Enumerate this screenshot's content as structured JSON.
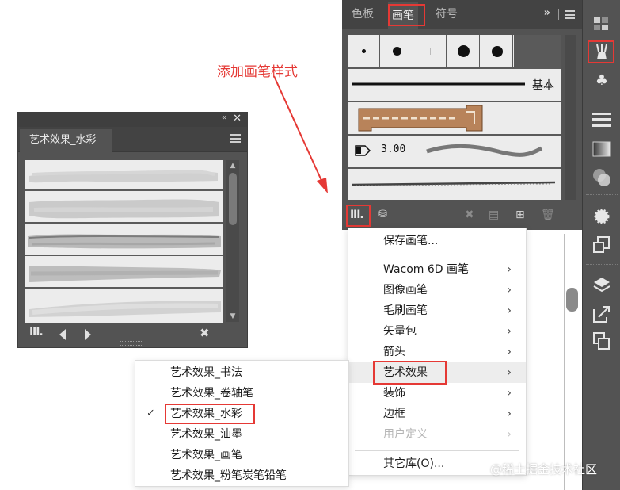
{
  "annotation": {
    "text": "添加画笔样式",
    "color": "#e53935"
  },
  "watercolor_panel": {
    "collapse_glyph": "«",
    "close_glyph": "✕",
    "tab_label": "艺术效果_水彩",
    "brush_count": 5,
    "scroll_up": "▲",
    "scroll_down": "▼"
  },
  "brushes_panel": {
    "tabs": [
      {
        "label": "色板",
        "active": false
      },
      {
        "label": "画笔",
        "active": true
      },
      {
        "label": "符号",
        "active": false
      }
    ],
    "overflow_glyph": "»",
    "brush_rows": {
      "basic_label": "基本",
      "size_label": "3.00"
    }
  },
  "context_menu": {
    "items": [
      {
        "label": "保存画笔...",
        "submenu": false,
        "disabled": false
      },
      {
        "label": "Wacom 6D 画笔",
        "submenu": true,
        "disabled": false
      },
      {
        "label": "图像画笔",
        "submenu": true,
        "disabled": false
      },
      {
        "label": "毛刷画笔",
        "submenu": true,
        "disabled": false
      },
      {
        "label": "矢量包",
        "submenu": true,
        "disabled": false
      },
      {
        "label": "箭头",
        "submenu": true,
        "disabled": false
      },
      {
        "label": "艺术效果",
        "submenu": true,
        "disabled": false,
        "highlighted": true
      },
      {
        "label": "装饰",
        "submenu": true,
        "disabled": false
      },
      {
        "label": "边框",
        "submenu": true,
        "disabled": false
      },
      {
        "label": "用户定义",
        "submenu": true,
        "disabled": true
      },
      {
        "label": "其它库(O)...",
        "submenu": false,
        "disabled": false
      }
    ],
    "submenu_arrow": "›"
  },
  "submenu": {
    "check_glyph": "✓",
    "items": [
      {
        "label": "艺术效果_书法",
        "checked": false
      },
      {
        "label": "艺术效果_卷轴笔",
        "checked": false
      },
      {
        "label": "艺术效果_水彩",
        "checked": true
      },
      {
        "label": "艺术效果_油墨",
        "checked": false
      },
      {
        "label": "艺术效果_画笔",
        "checked": false
      },
      {
        "label": "艺术效果_粉笔炭笔铅笔",
        "checked": false
      }
    ]
  },
  "toolbar": {
    "icons": [
      "swatches-icon",
      "brushes-icon",
      "symbols-icon",
      "stroke-icon",
      "gradient-icon",
      "transparency-icon",
      "appearance-icon",
      "graphic-styles-icon",
      "layers-icon",
      "export-icon",
      "artboards-icon"
    ]
  },
  "watermark": "@稀土掘金技术社区",
  "colors": {
    "accent_red": "#e53935",
    "panel_bg": "#535353",
    "panel_dark": "#434343",
    "swatch_bg": "#ececec"
  }
}
